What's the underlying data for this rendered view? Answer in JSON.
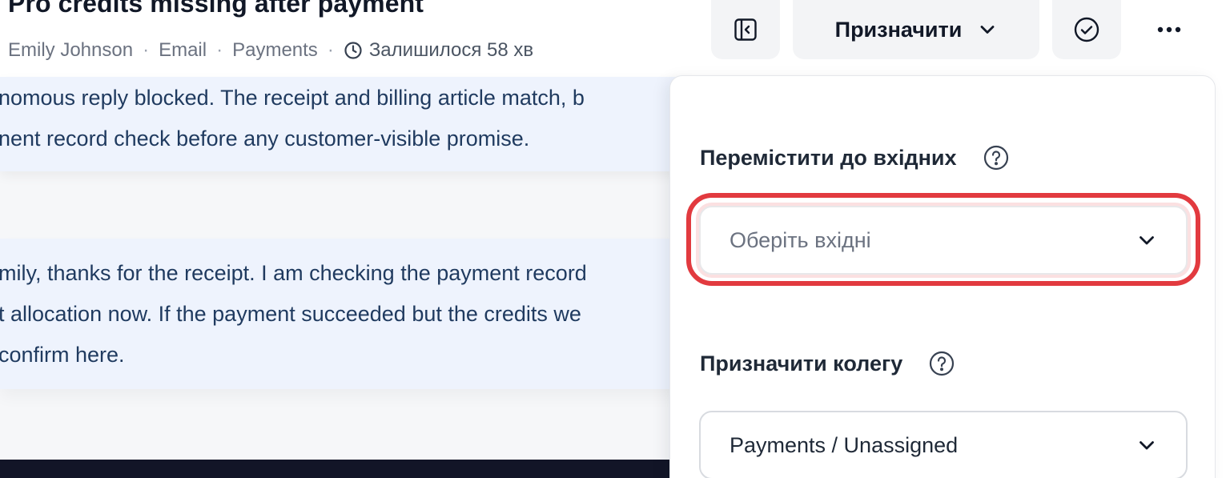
{
  "header": {
    "title": "Pro credits missing after payment",
    "meta": {
      "customer": "Emily Johnson",
      "channel": "Email",
      "team": "Payments",
      "time_left": "Залишилося 58 хв",
      "separator": "·"
    }
  },
  "toolbar": {
    "assign_label": "Призначити"
  },
  "conversation": {
    "note_lines": [
      "nomous reply blocked. The receipt and billing article match, b",
      "nent record check before any customer-visible promise."
    ],
    "reply_lines": [
      "mily, thanks for the receipt. I am checking the payment record",
      "t allocation now. If the payment succeeded but the credits we",
      "confirm here."
    ]
  },
  "assign_panel": {
    "move_inbox_label": "Перемістити до вхідних",
    "inbox_select_placeholder": "Оберіть вхідні",
    "assign_colleague_label": "Призначити колегу",
    "colleague_select_value": "Payments / Unassigned"
  },
  "colors": {
    "highlight": "#e23a3f",
    "bubble_bg": "#eef3fd",
    "bubble_text": "#1f3a5f",
    "toolbar_bg": "#f3f4f6",
    "bottom_bar": "#121527"
  }
}
